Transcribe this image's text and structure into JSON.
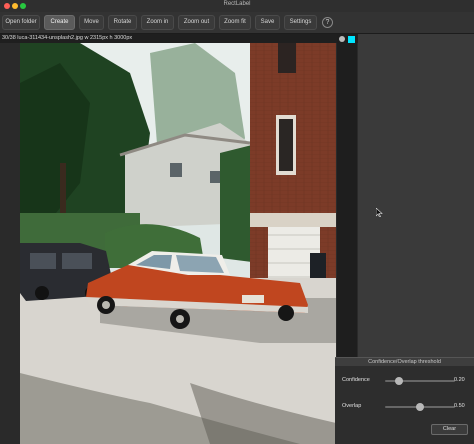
{
  "window": {
    "title": "RectLabel"
  },
  "toolbar": {
    "buttons": [
      {
        "label": "Open folder"
      },
      {
        "label": "Create"
      },
      {
        "label": "Move"
      },
      {
        "label": "Rotate"
      },
      {
        "label": "Zoom in"
      },
      {
        "label": "Zoom out"
      },
      {
        "label": "Zoom fit"
      },
      {
        "label": "Save"
      },
      {
        "label": "Settings"
      }
    ],
    "help_label": "?"
  },
  "image_info": "30/38 luca-311434-unsplash2.jpg w 2315px h 3000px",
  "threshold_panel": {
    "title": "Confidence/Overlap threshold",
    "confidence": {
      "label": "Confidence",
      "value": "0.20",
      "fraction": 0.2
    },
    "overlap": {
      "label": "Overlap",
      "value": "0.50",
      "fraction": 0.5
    },
    "clear_label": "Clear"
  },
  "colors": {
    "accent": "#00e5ff",
    "car": "#c0461f"
  }
}
